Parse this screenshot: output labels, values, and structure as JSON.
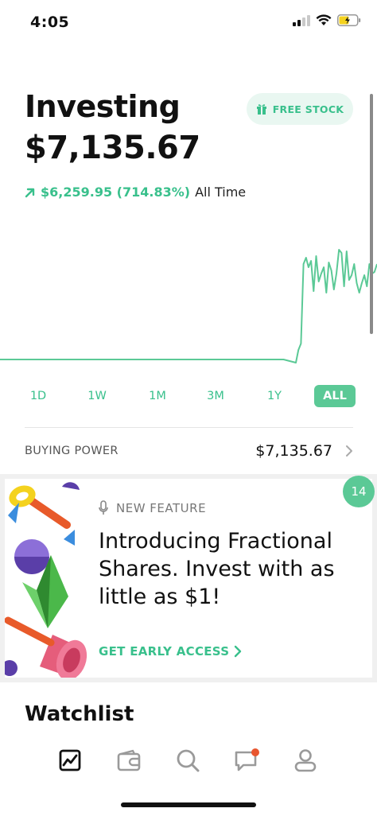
{
  "status": {
    "time": "4:05"
  },
  "header": {
    "title": "Investing",
    "value": "$7,135.67",
    "free_stock_label": "FREE STOCK",
    "gain_value": "$6,259.95 (714.83%)",
    "gain_period": "All Time"
  },
  "chart_data": {
    "type": "line",
    "color": "#5bc996",
    "x_range": [
      "start",
      "end"
    ],
    "series": [
      {
        "values": [
          0.02,
          0.02,
          0.02,
          0.02,
          0.02,
          0.02,
          0.02,
          0.02,
          0.02,
          0.02,
          0.02,
          0.02,
          0.02,
          0.02,
          0.02,
          0.02,
          0.02,
          0.02,
          0.02,
          0.02,
          0.02,
          0.02,
          0.02,
          0.02,
          0.0,
          0.08,
          0.12,
          0.62,
          0.66,
          0.6,
          0.64,
          0.45,
          0.67,
          0.51,
          0.56,
          0.6,
          0.44,
          0.63,
          0.58,
          0.46,
          0.56,
          0.71,
          0.69,
          0.48,
          0.7,
          0.52,
          0.55,
          0.62,
          0.5,
          0.44,
          0.5,
          0.55,
          0.48,
          0.62,
          0.56,
          0.57,
          0.62
        ]
      }
    ]
  },
  "ranges": {
    "d1": "1D",
    "w1": "1W",
    "m1": "1M",
    "m3": "3M",
    "y1": "1Y",
    "all": "ALL"
  },
  "buying_power": {
    "label": "BUYING POWER",
    "value": "$7,135.67"
  },
  "promo": {
    "badge": "14",
    "eyebrow": "NEW FEATURE",
    "headline": "Introducing Fractional Shares. Invest with as little as $1!",
    "cta": "GET EARLY ACCESS"
  },
  "watchlist": {
    "title": "Watchlist"
  },
  "tabs": {
    "items": [
      "portfolio-icon",
      "wallet-icon",
      "search-icon",
      "messages-icon",
      "account-icon"
    ]
  },
  "colors": {
    "accent": "#39c08c",
    "accent_fill": "#5bc996",
    "notification": "#e8552e"
  }
}
